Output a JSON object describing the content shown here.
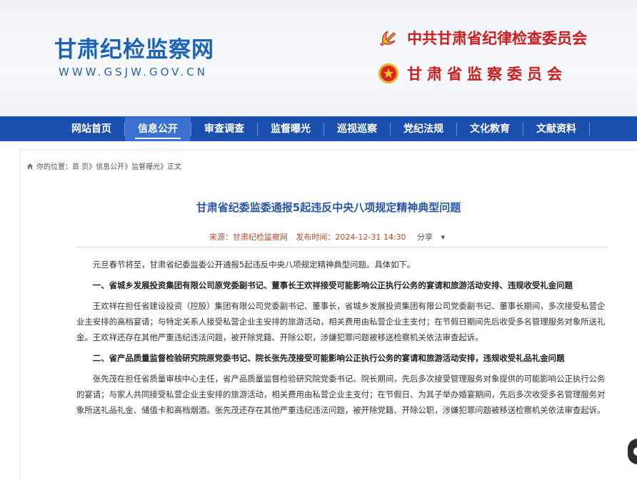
{
  "header": {
    "site_title": "甘肃纪检监察网",
    "site_url": "WWW.GSJW.GOV.CN",
    "org_line1": "中共甘肃省纪律检查委员会",
    "org_line2": "甘肃省监察委员会"
  },
  "nav": {
    "items": [
      {
        "label": "网站首页"
      },
      {
        "label": "信息公开",
        "active": true
      },
      {
        "label": "审查调查"
      },
      {
        "label": "监督曝光"
      },
      {
        "label": "巡视巡察"
      },
      {
        "label": "党纪法规"
      },
      {
        "label": "文化教育"
      },
      {
        "label": "文献资料"
      }
    ]
  },
  "breadcrumb": {
    "prefix": "你的位置：",
    "home": "首 页",
    "sep1": "》",
    "section": "信息公开",
    "sep2": "》",
    "sub": "监督曝光",
    "sep3": "》",
    "current": "正文"
  },
  "article": {
    "title": "甘肃省纪委监委通报5起违反中央八项规定精神典型问题",
    "source": "来源：甘肃纪检监察网",
    "published": "发布时间：2024-12-31 14:30",
    "share": "分享",
    "paragraphs": [
      {
        "text": "元旦春节将至，甘肃省纪委监委公开通报5起违反中央八项规定精神典型问题。具体如下。",
        "heading": false
      },
      {
        "text": "一、省城乡发展投资集团有限公司原党委副书记、董事长王欢祥接受可能影响公正执行公务的宴请和旅游活动安排、违规收受礼金问题",
        "heading": true
      },
      {
        "text": "王欢祥在担任省建设投资（控股）集团有限公司党委副书记、董事长，省城乡发展投资集团有限公司党委副书记、董事长期间，多次接受私营企业主安排的高档宴请；与特定关系人接受私营企业主安排的旅游活动，相关费用由私营企业主支付；在节假日期间先后收受多名管理服务对象所送礼金。王欢祥还存在其他严重违纪违法问题，被开除党籍、开除公职，涉嫌犯罪问题被移送检察机关依法审查起诉。",
        "heading": false
      },
      {
        "text": "二、省产品质量监督检验研究院原党委书记、院长张先茂接受可能影响公正执行公务的宴请和旅游活动安排，违规收受礼品礼金问题",
        "heading": true
      },
      {
        "text": "张先茂在担任省质量审核中心主任，省产品质量监督检验研究院党委书记、院长期间，先后多次接受管理服务对象提供的可能影响公正执行公务的宴请；与家人共同接受私营企业主安排的旅游活动，相关费用由私营企业主支付；在节假日、为其子举办婚宴期间，先后多次收受多名管理服务对象所送礼品礼金、储值卡和高档烟酒。张先茂还存在其他严重违纪违法问题，被开除党籍、开除公职，涉嫌犯罪问题被移送检察机关依法审查起诉。",
        "heading": false
      }
    ]
  },
  "colors": {
    "nav_bg": "#1a4fb0",
    "title_blue": "#2a56a6",
    "org_red": "#c81e1e"
  }
}
